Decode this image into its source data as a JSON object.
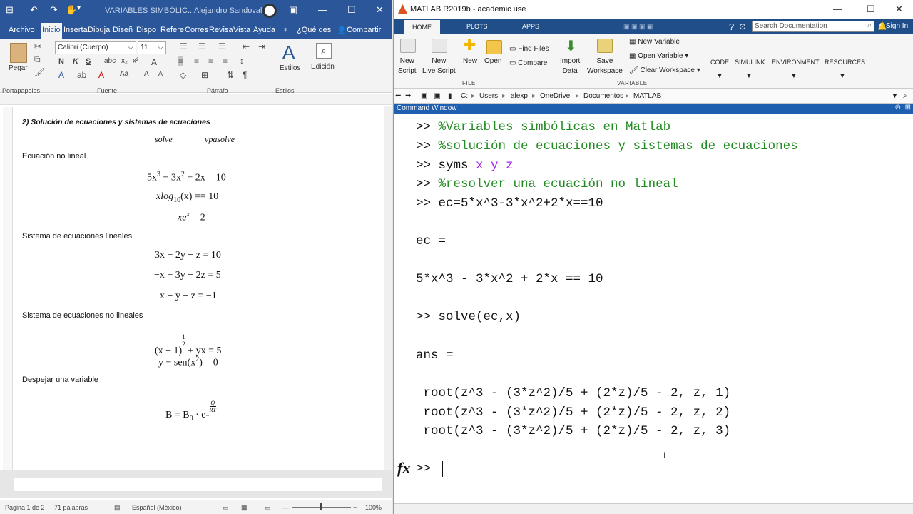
{
  "word": {
    "title": "VARIABLES SIMBÓLIC...",
    "user": "Alejandro Sandoval",
    "tabs": [
      "Archivo",
      "Inicio",
      "Inserta",
      "Dibuja",
      "Diseñ",
      "Dispo",
      "Refere",
      "Corres",
      "Revisa",
      "Vista",
      "Ayuda"
    ],
    "tell_me": "¿Qué des",
    "share": "Compartir",
    "ribbon": {
      "paste": "Pegar",
      "font_name": "Calibri (Cuerpo)",
      "font_size": "11",
      "styles": "Estilos",
      "editing": "Edición",
      "groups": [
        "Portapapeles",
        "Fuente",
        "Párrafo",
        "Estilos"
      ]
    },
    "doc": {
      "heading": "2)   Solución de ecuaciones y sistemas de ecuaciones",
      "funcs": [
        "solve",
        "vpasolve"
      ],
      "sec1": "Ecuación no lineal",
      "sec2": "Sistema de ecuaciones lineales",
      "sec3": "Sistema de ecuaciones no lineales",
      "sec4": "Despejar una variable",
      "eq": {
        "e1a": "5x",
        "e1b": "3",
        "e1c": " − 3x",
        "e1d": "2",
        "e1e": " + 2x = 10",
        "e2a": "xlog",
        "e2b": "10",
        "e2c": "(x) == 10",
        "e3a": "xe",
        "e3b": "x",
        "e3c": " = 2",
        "l1": "3x + 2y − z = 10",
        "l2": "−x + 3y − 2z = 5",
        "l3": "x − y − z = −1",
        "n1a": "(x − 1)",
        "n1num": "1",
        "n1den": "2",
        "n1b": " + yx = 5",
        "n2a": "y − sen(x",
        "n2b": "2",
        "n2c": ") = 0",
        "b1": "B = B",
        "b2": "0",
        "b3": " · e",
        "bnum": "Q",
        "bden": "RT",
        "bminus": "−"
      }
    },
    "status": {
      "page": "Página 1 de 2",
      "words": "71 palabras",
      "lang": "Español (México)",
      "zoom": "100%"
    }
  },
  "matlab": {
    "title": "MATLAB R2019b - academic use",
    "tabs": [
      "HOME",
      "PLOTS",
      "APPS"
    ],
    "search_placeholder": "Search Documentation",
    "signin": "Sign In",
    "ribbon": {
      "new_script": [
        "New",
        "Script"
      ],
      "new_live": [
        "New",
        "Live Script"
      ],
      "new": "New",
      "open": "Open",
      "find_files": "Find Files",
      "compare": "Compare",
      "import": [
        "Import",
        "Data"
      ],
      "save_ws": [
        "Save",
        "Workspace"
      ],
      "new_var": "New Variable",
      "open_var": "Open Variable ▾",
      "clear_ws": "Clear Workspace ▾",
      "code": "CODE",
      "simulink": "SIMULINK",
      "environment": "ENVIRONMENT",
      "resources": "RESOURCES",
      "file_label": "FILE",
      "variable_label": "VARIABLE"
    },
    "path": [
      "C:",
      "Users",
      "alexp",
      "OneDrive",
      "Documentos",
      "MATLAB"
    ],
    "cw_title": "Command Window",
    "lines": {
      "l1p": ">> ",
      "l1": "%Variables simbólicas en Matlab",
      "l2p": ">> ",
      "l2": "%solución de ecuaciones y sistemas de ecuaciones",
      "l3p": ">> syms ",
      "l3": "x y z",
      "l4p": ">> ",
      "l4": "%resolver una ecuación no lineal",
      "l5": ">> ec=5*x^3-3*x^2+2*x==10",
      "l6": "ec =",
      "l7": "5*x^3 - 3*x^2 + 2*x == 10",
      "l8": ">> solve(ec,x)",
      "l9": "ans =",
      "r1": " root(z^3 - (3*z^2)/5 + (2*z)/5 - 2, z, 1)",
      "r2": " root(z^3 - (3*z^2)/5 + (2*z)/5 - 2, z, 2)",
      "r3": " root(z^3 - (3*z^2)/5 + (2*z)/5 - 2, z, 3)",
      "prompt": ">> "
    },
    "fx": "fx",
    "colors": {
      "comment": "#228b22",
      "symbolic": "#a020f0",
      "tabbar": "#1f4e88"
    }
  }
}
